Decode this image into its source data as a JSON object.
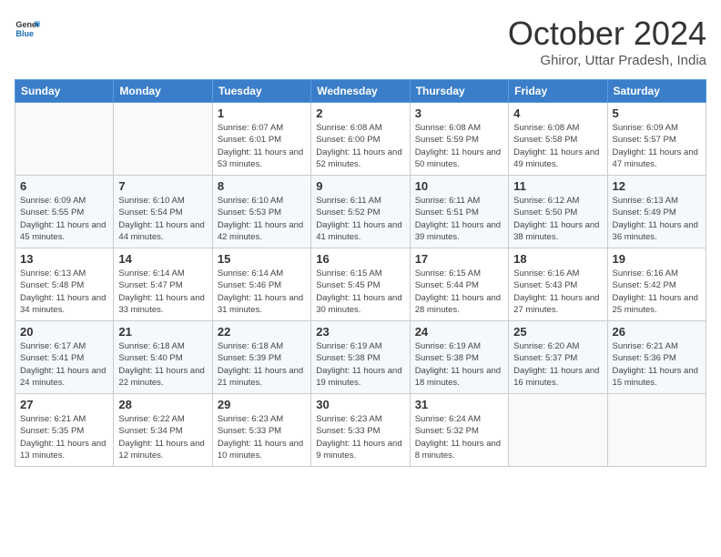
{
  "logo": {
    "line1": "General",
    "line2": "Blue"
  },
  "header": {
    "month": "October 2024",
    "location": "Ghiror, Uttar Pradesh, India"
  },
  "weekdays": [
    "Sunday",
    "Monday",
    "Tuesday",
    "Wednesday",
    "Thursday",
    "Friday",
    "Saturday"
  ],
  "weeks": [
    [
      {
        "day": "",
        "info": ""
      },
      {
        "day": "",
        "info": ""
      },
      {
        "day": "1",
        "info": "Sunrise: 6:07 AM\nSunset: 6:01 PM\nDaylight: 11 hours and 53 minutes."
      },
      {
        "day": "2",
        "info": "Sunrise: 6:08 AM\nSunset: 6:00 PM\nDaylight: 11 hours and 52 minutes."
      },
      {
        "day": "3",
        "info": "Sunrise: 6:08 AM\nSunset: 5:59 PM\nDaylight: 11 hours and 50 minutes."
      },
      {
        "day": "4",
        "info": "Sunrise: 6:08 AM\nSunset: 5:58 PM\nDaylight: 11 hours and 49 minutes."
      },
      {
        "day": "5",
        "info": "Sunrise: 6:09 AM\nSunset: 5:57 PM\nDaylight: 11 hours and 47 minutes."
      }
    ],
    [
      {
        "day": "6",
        "info": "Sunrise: 6:09 AM\nSunset: 5:55 PM\nDaylight: 11 hours and 45 minutes."
      },
      {
        "day": "7",
        "info": "Sunrise: 6:10 AM\nSunset: 5:54 PM\nDaylight: 11 hours and 44 minutes."
      },
      {
        "day": "8",
        "info": "Sunrise: 6:10 AM\nSunset: 5:53 PM\nDaylight: 11 hours and 42 minutes."
      },
      {
        "day": "9",
        "info": "Sunrise: 6:11 AM\nSunset: 5:52 PM\nDaylight: 11 hours and 41 minutes."
      },
      {
        "day": "10",
        "info": "Sunrise: 6:11 AM\nSunset: 5:51 PM\nDaylight: 11 hours and 39 minutes."
      },
      {
        "day": "11",
        "info": "Sunrise: 6:12 AM\nSunset: 5:50 PM\nDaylight: 11 hours and 38 minutes."
      },
      {
        "day": "12",
        "info": "Sunrise: 6:13 AM\nSunset: 5:49 PM\nDaylight: 11 hours and 36 minutes."
      }
    ],
    [
      {
        "day": "13",
        "info": "Sunrise: 6:13 AM\nSunset: 5:48 PM\nDaylight: 11 hours and 34 minutes."
      },
      {
        "day": "14",
        "info": "Sunrise: 6:14 AM\nSunset: 5:47 PM\nDaylight: 11 hours and 33 minutes."
      },
      {
        "day": "15",
        "info": "Sunrise: 6:14 AM\nSunset: 5:46 PM\nDaylight: 11 hours and 31 minutes."
      },
      {
        "day": "16",
        "info": "Sunrise: 6:15 AM\nSunset: 5:45 PM\nDaylight: 11 hours and 30 minutes."
      },
      {
        "day": "17",
        "info": "Sunrise: 6:15 AM\nSunset: 5:44 PM\nDaylight: 11 hours and 28 minutes."
      },
      {
        "day": "18",
        "info": "Sunrise: 6:16 AM\nSunset: 5:43 PM\nDaylight: 11 hours and 27 minutes."
      },
      {
        "day": "19",
        "info": "Sunrise: 6:16 AM\nSunset: 5:42 PM\nDaylight: 11 hours and 25 minutes."
      }
    ],
    [
      {
        "day": "20",
        "info": "Sunrise: 6:17 AM\nSunset: 5:41 PM\nDaylight: 11 hours and 24 minutes."
      },
      {
        "day": "21",
        "info": "Sunrise: 6:18 AM\nSunset: 5:40 PM\nDaylight: 11 hours and 22 minutes."
      },
      {
        "day": "22",
        "info": "Sunrise: 6:18 AM\nSunset: 5:39 PM\nDaylight: 11 hours and 21 minutes."
      },
      {
        "day": "23",
        "info": "Sunrise: 6:19 AM\nSunset: 5:38 PM\nDaylight: 11 hours and 19 minutes."
      },
      {
        "day": "24",
        "info": "Sunrise: 6:19 AM\nSunset: 5:38 PM\nDaylight: 11 hours and 18 minutes."
      },
      {
        "day": "25",
        "info": "Sunrise: 6:20 AM\nSunset: 5:37 PM\nDaylight: 11 hours and 16 minutes."
      },
      {
        "day": "26",
        "info": "Sunrise: 6:21 AM\nSunset: 5:36 PM\nDaylight: 11 hours and 15 minutes."
      }
    ],
    [
      {
        "day": "27",
        "info": "Sunrise: 6:21 AM\nSunset: 5:35 PM\nDaylight: 11 hours and 13 minutes."
      },
      {
        "day": "28",
        "info": "Sunrise: 6:22 AM\nSunset: 5:34 PM\nDaylight: 11 hours and 12 minutes."
      },
      {
        "day": "29",
        "info": "Sunrise: 6:23 AM\nSunset: 5:33 PM\nDaylight: 11 hours and 10 minutes."
      },
      {
        "day": "30",
        "info": "Sunrise: 6:23 AM\nSunset: 5:33 PM\nDaylight: 11 hours and 9 minutes."
      },
      {
        "day": "31",
        "info": "Sunrise: 6:24 AM\nSunset: 5:32 PM\nDaylight: 11 hours and 8 minutes."
      },
      {
        "day": "",
        "info": ""
      },
      {
        "day": "",
        "info": ""
      }
    ]
  ]
}
